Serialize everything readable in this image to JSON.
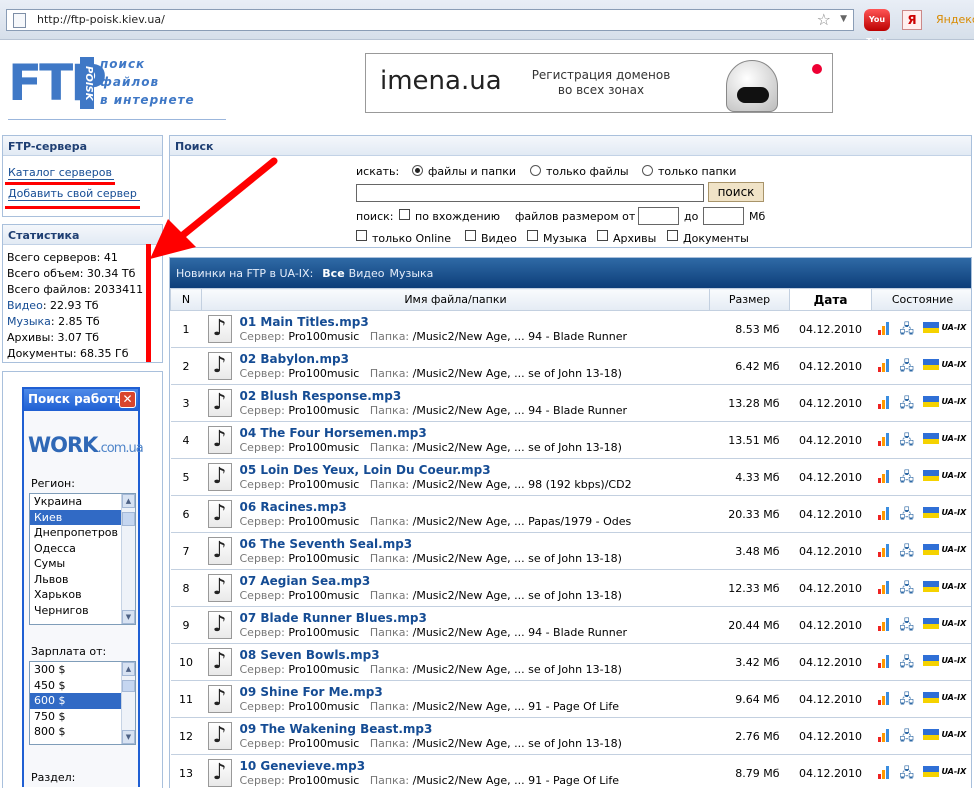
{
  "browser": {
    "url": "http://ftp-poisk.kiev.ua/",
    "youtube_label": "You Tube",
    "yandex_label": "Я",
    "yandex_text": "Яндекс"
  },
  "logo": {
    "ftp": "FTP",
    "vertical": "POISK",
    "line1": "поиск",
    "line2": "файлов",
    "line3": "в интернете"
  },
  "banner": {
    "brand": "imena.ua",
    "slogan_1": "Регистрация доменов",
    "slogan_2": "во всех зонах"
  },
  "servers_panel": {
    "title": "FTP-сервера",
    "catalog": "Каталог серверов",
    "add": "Добавить свой сервер"
  },
  "stats_panel": {
    "title": "Статистика",
    "servers": "Всего серверов: 41",
    "volume": "Всего объем: 30.34 Тб",
    "files": "Всего файлов: 2033411",
    "video_label": "Видео",
    "video_value": ": 22.93 Тб",
    "music_label": "Музыка",
    "music_value": ": 2.85 Тб",
    "archives": "Архивы: 3.07 Тб",
    "documents": "Документы: 68.35 Гб"
  },
  "work_widget": {
    "title": "Поиск работы",
    "logo_main": "WORK",
    "logo_domain": ".com.ua",
    "region_label": "Регион:",
    "regions": [
      "Украина",
      "Киев",
      "Днепропетров",
      "Одесса",
      "Сумы",
      "Львов",
      "Харьков",
      "Чернигов"
    ],
    "selected_region": "Киев",
    "salary_label": "Зарплата от:",
    "salaries": [
      "300 $",
      "450 $",
      "600 $",
      "750 $",
      "800 $"
    ],
    "selected_salary": "600 $",
    "section_label": "Раздел:"
  },
  "search_panel": {
    "title": "Поиск",
    "search_label": "искать:",
    "opt_all": "файлы и папки",
    "opt_files": "только файлы",
    "opt_folders": "только папки",
    "query": "",
    "button": "поиск",
    "mode_label": "поиск:",
    "partial": "по вхождению",
    "size_label": "файлов размером от",
    "to_label": "до",
    "unit": "Мб",
    "only_online": "только Online",
    "video": "Видео",
    "music": "Музыка",
    "archives": "Архивы",
    "documents": "Документы"
  },
  "results": {
    "tab_title": "Новинки на FTP в UA-IX:",
    "tab_all": "Все",
    "tab_video": "Видео",
    "tab_music": "Музыка",
    "columns": [
      "N",
      "Имя файла/папки",
      "Размер",
      "Дата",
      "Состояние"
    ],
    "server_label": "Сервер:",
    "folder_label": "Папка:",
    "uaix": "UA-IX",
    "rows": [
      {
        "n": "1",
        "name": "01 Main Titles.mp3",
        "server": "Pro100music",
        "folder": "/Music2/New Age, ... 94 - Blade Runner",
        "size": "8.53 Мб",
        "date": "04.12.2010"
      },
      {
        "n": "2",
        "name": "02 Babylon.mp3",
        "server": "Pro100music",
        "folder": "/Music2/New Age, ... se of John 13-18)",
        "size": "6.42 Мб",
        "date": "04.12.2010"
      },
      {
        "n": "3",
        "name": "02 Blush Response.mp3",
        "server": "Pro100music",
        "folder": "/Music2/New Age, ... 94 - Blade Runner",
        "size": "13.28 Мб",
        "date": "04.12.2010"
      },
      {
        "n": "4",
        "name": "04 The Four Horsemen.mp3",
        "server": "Pro100music",
        "folder": "/Music2/New Age, ... se of John 13-18)",
        "size": "13.51 Мб",
        "date": "04.12.2010"
      },
      {
        "n": "5",
        "name": "05 Loin Des Yeux, Loin Du Coeur.mp3",
        "server": "Pro100music",
        "folder": "/Music2/New Age, ... 98 (192 kbps)/CD2",
        "size": "4.33 Мб",
        "date": "04.12.2010"
      },
      {
        "n": "6",
        "name": "06 Racines.mp3",
        "server": "Pro100music",
        "folder": "/Music2/New Age, ... Papas/1979 - Odes",
        "size": "20.33 Мб",
        "date": "04.12.2010"
      },
      {
        "n": "7",
        "name": "06 The Seventh Seal.mp3",
        "server": "Pro100music",
        "folder": "/Music2/New Age, ... se of John 13-18)",
        "size": "3.48 Мб",
        "date": "04.12.2010"
      },
      {
        "n": "8",
        "name": "07 Aegian Sea.mp3",
        "server": "Pro100music",
        "folder": "/Music2/New Age, ... se of John 13-18)",
        "size": "12.33 Мб",
        "date": "04.12.2010"
      },
      {
        "n": "9",
        "name": "07 Blade Runner Blues.mp3",
        "server": "Pro100music",
        "folder": "/Music2/New Age, ... 94 - Blade Runner",
        "size": "20.44 Мб",
        "date": "04.12.2010"
      },
      {
        "n": "10",
        "name": "08 Seven Bowls.mp3",
        "server": "Pro100music",
        "folder": "/Music2/New Age, ... se of John 13-18)",
        "size": "3.42 Мб",
        "date": "04.12.2010"
      },
      {
        "n": "11",
        "name": "09 Shine For Me.mp3",
        "server": "Pro100music",
        "folder": "/Music2/New Age, ... 91 - Page Of Life",
        "size": "9.64 Мб",
        "date": "04.12.2010"
      },
      {
        "n": "12",
        "name": "09 The Wakening Beast.mp3",
        "server": "Pro100music",
        "folder": "/Music2/New Age, ... se of John 13-18)",
        "size": "2.76 Мб",
        "date": "04.12.2010"
      },
      {
        "n": "13",
        "name": "10 Genevieve.mp3",
        "server": "Pro100music",
        "folder": "/Music2/New Age, ... 91 - Page Of Life",
        "size": "8.79 Мб",
        "date": "04.12.2010"
      }
    ]
  },
  "colors": {
    "link": "#154c94",
    "accent": "#3f78c6",
    "annotation": "#ff0000"
  }
}
